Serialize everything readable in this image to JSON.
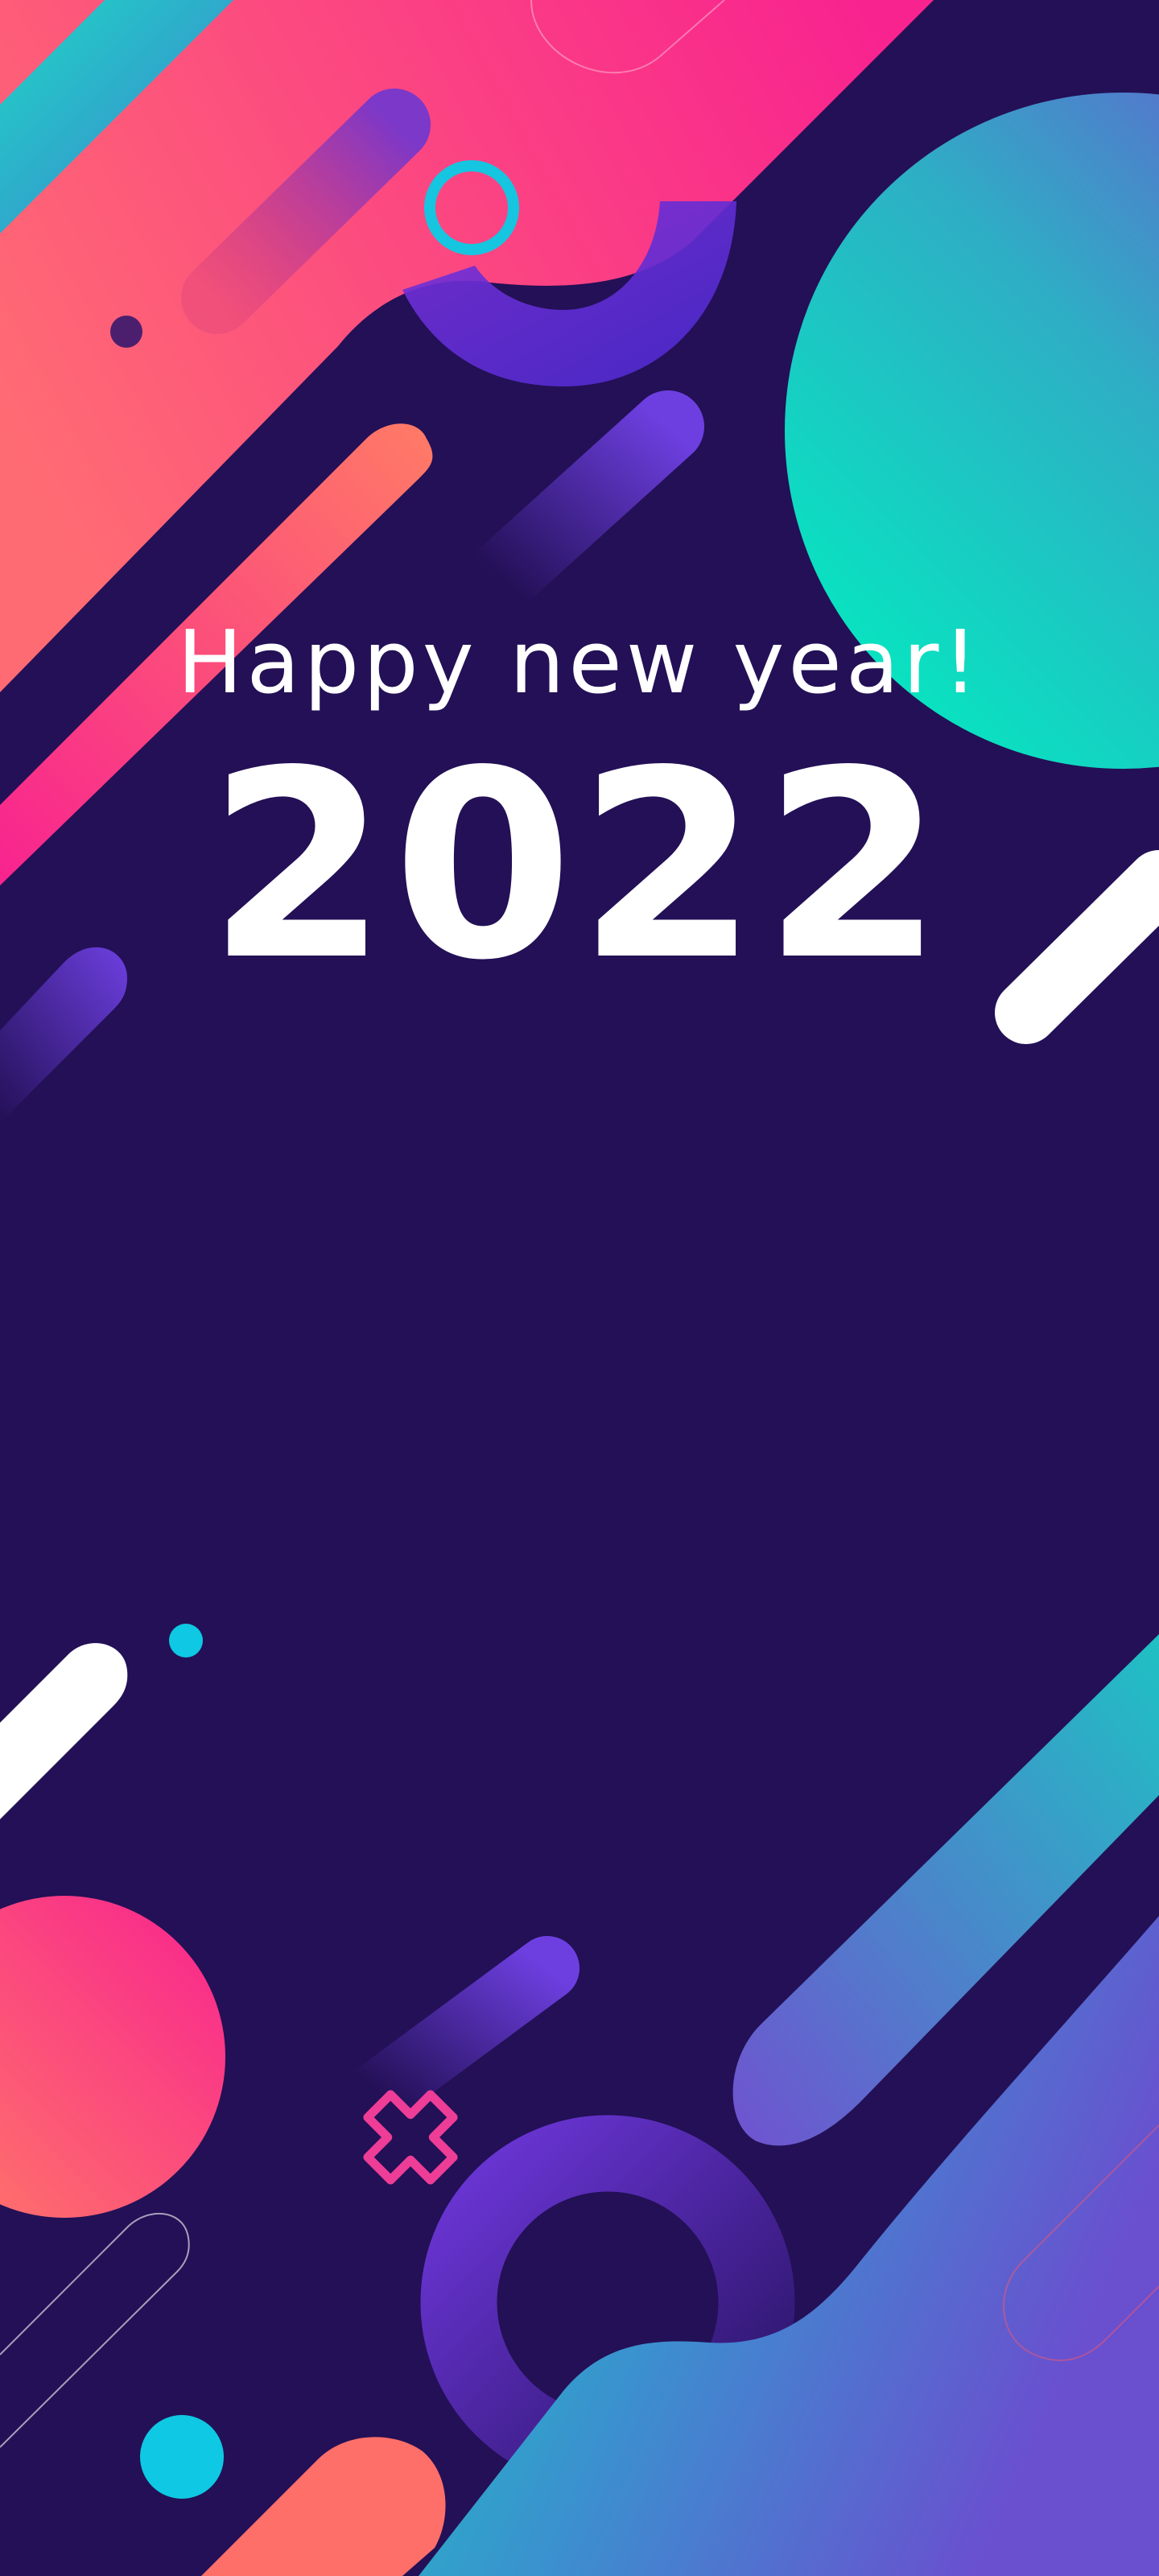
{
  "banner": {
    "greeting": "Happy new year!",
    "year": "2022"
  },
  "colors": {
    "background": "#231056",
    "pink": "#f8258f",
    "coral": "#ff6e6e",
    "teal": "#08e3c2",
    "cyan": "#0fc8e3",
    "violet": "#6a3fd9",
    "white": "#ffffff"
  }
}
